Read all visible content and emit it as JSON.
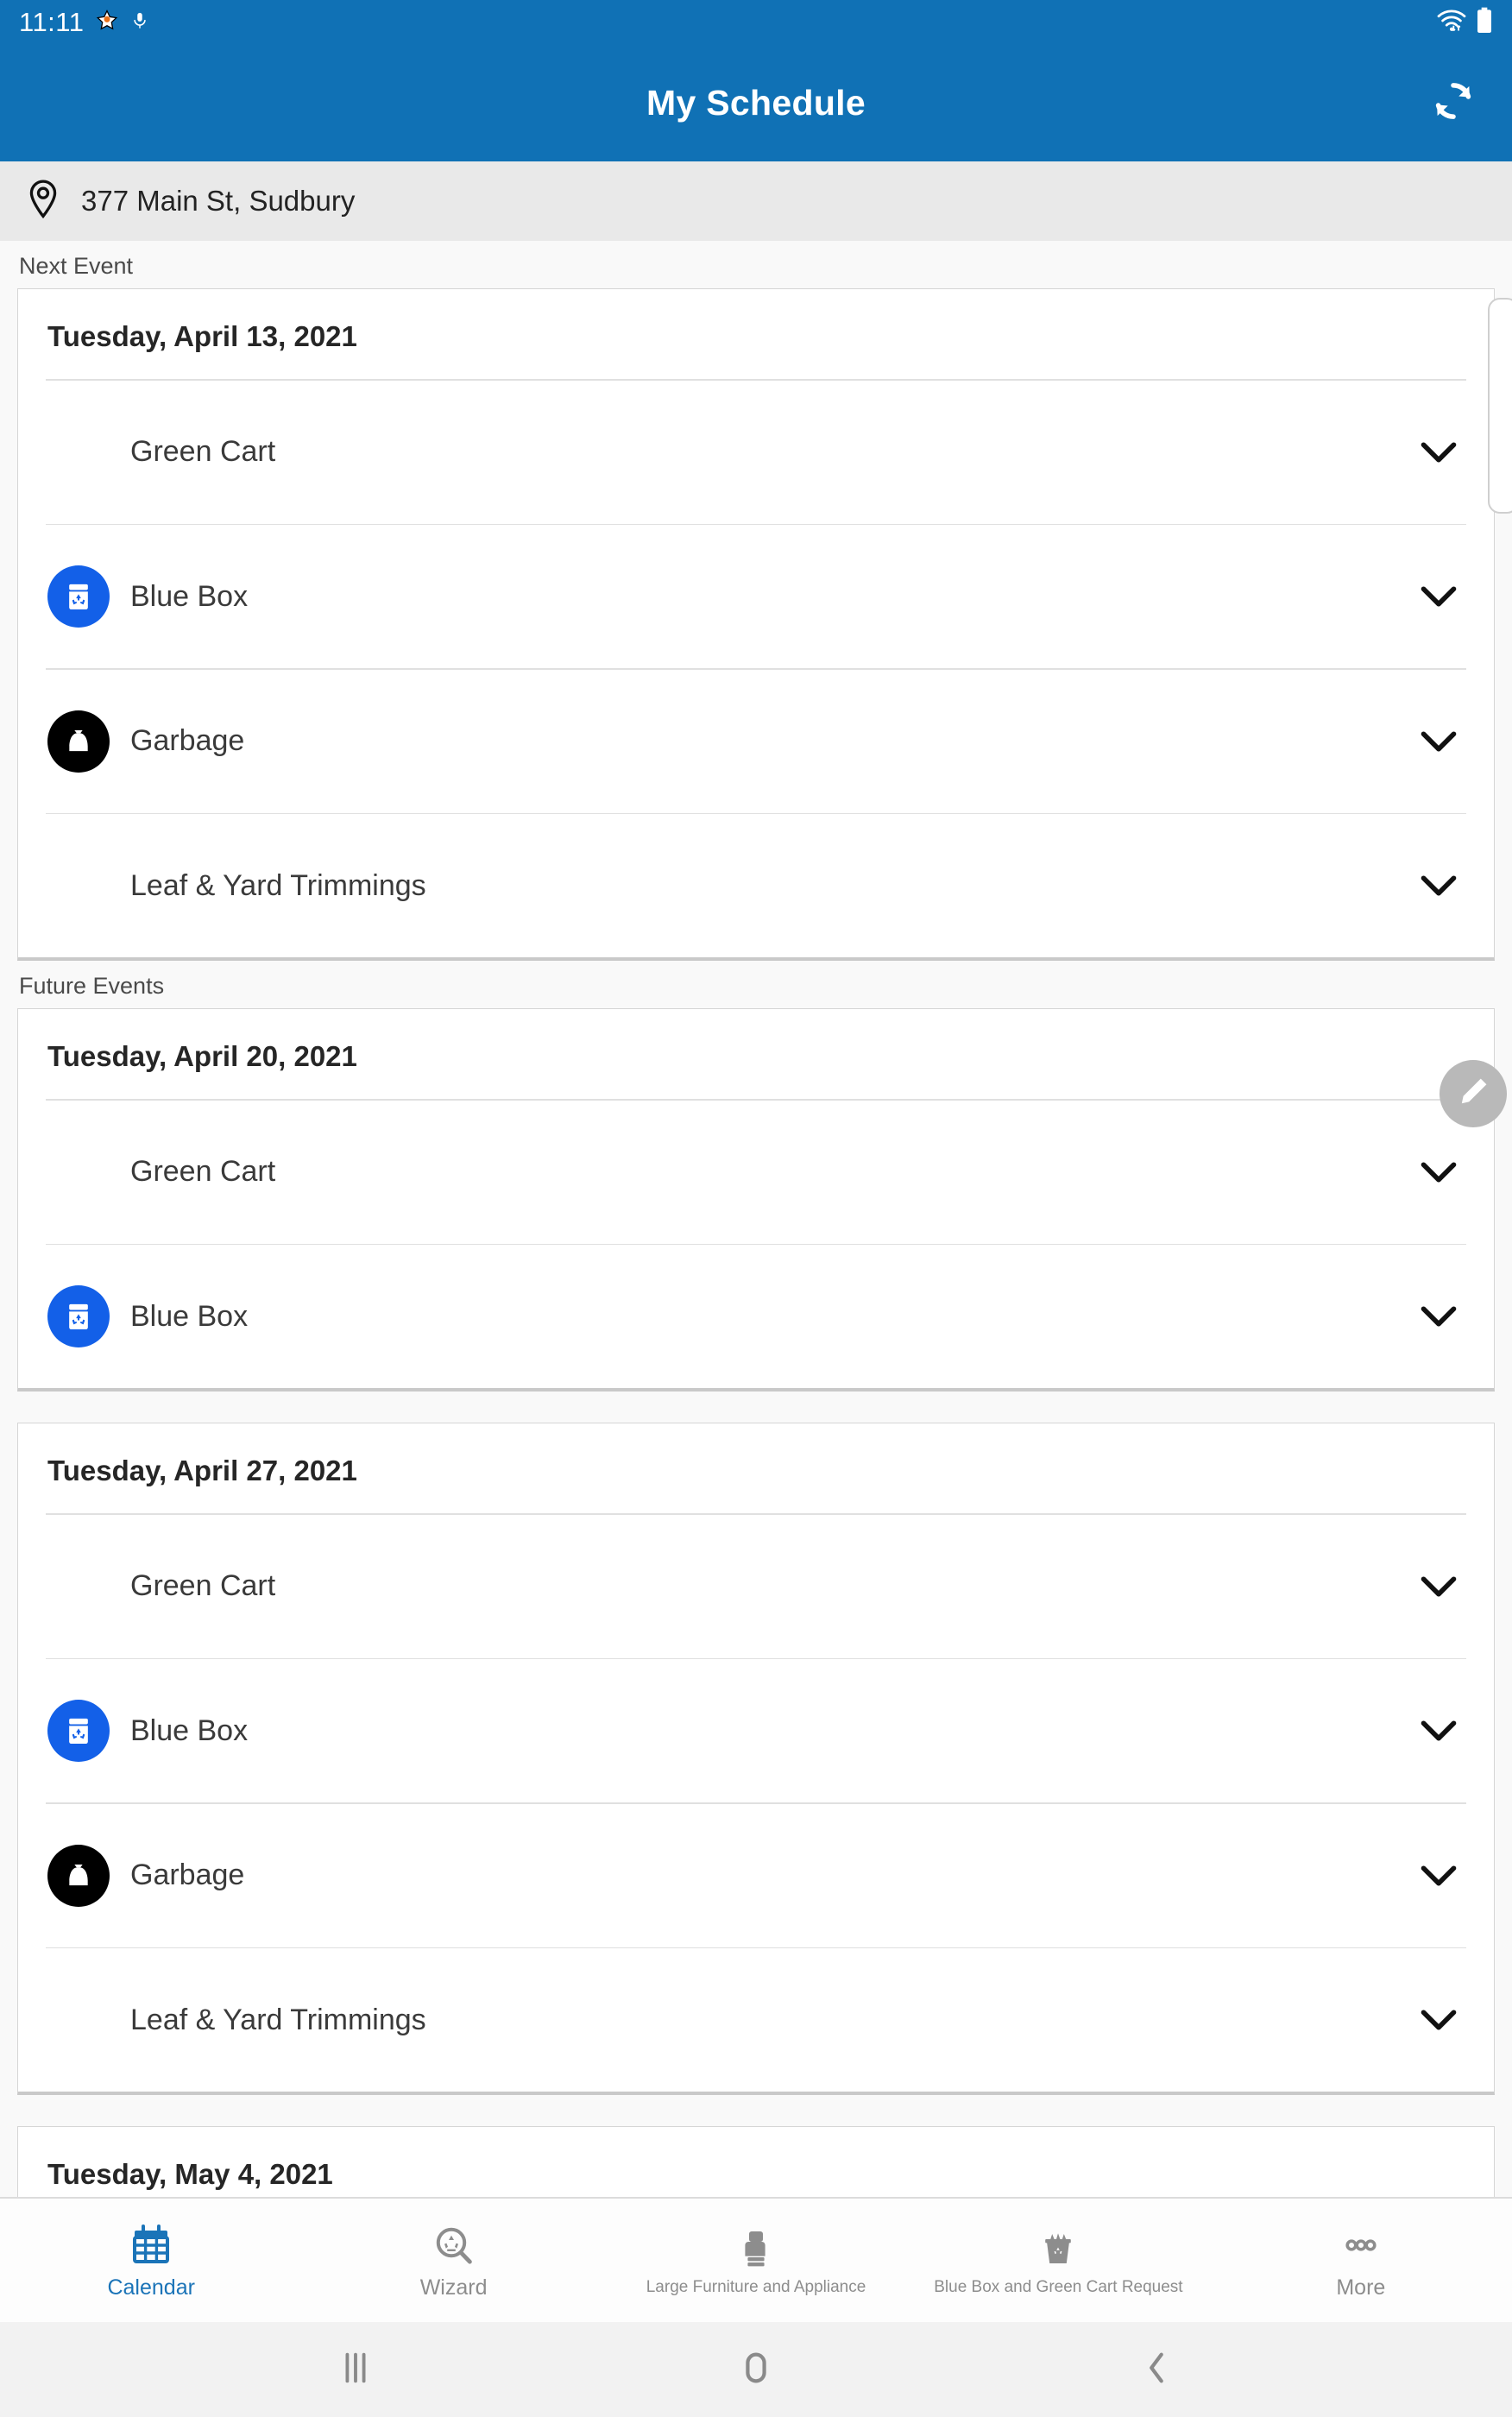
{
  "status_bar": {
    "time": "11:11",
    "icons": [
      "star-icon",
      "microphone-icon",
      "wifi-icon",
      "battery-icon"
    ]
  },
  "app_bar": {
    "title": "My Schedule",
    "action_icon": "refresh-icon"
  },
  "address_bar": {
    "icon": "location-pin-icon",
    "address": "377 Main St, Sudbury"
  },
  "sections": {
    "next_event_label": "Next Event",
    "future_events_label": "Future Events"
  },
  "events": [
    {
      "date": "Tuesday, April 13, 2021",
      "items": [
        {
          "label": "Green Cart",
          "icon": "none",
          "chevron": "chevron-down-icon"
        },
        {
          "label": "Blue Box",
          "icon": "recycle-bin-icon",
          "chevron": "chevron-down-icon"
        },
        {
          "label": "Garbage",
          "icon": "garbage-bag-icon",
          "chevron": "chevron-down-icon"
        },
        {
          "label": "Leaf & Yard Trimmings",
          "icon": "none",
          "chevron": "chevron-down-icon"
        }
      ]
    },
    {
      "date": "Tuesday, April 20, 2021",
      "items": [
        {
          "label": "Green Cart",
          "icon": "none",
          "chevron": "chevron-down-icon"
        },
        {
          "label": "Blue Box",
          "icon": "recycle-bin-icon",
          "chevron": "chevron-down-icon"
        }
      ]
    },
    {
      "date": "Tuesday, April 27, 2021",
      "items": [
        {
          "label": "Green Cart",
          "icon": "none",
          "chevron": "chevron-down-icon"
        },
        {
          "label": "Blue Box",
          "icon": "recycle-bin-icon",
          "chevron": "chevron-down-icon"
        },
        {
          "label": "Garbage",
          "icon": "garbage-bag-icon",
          "chevron": "chevron-down-icon"
        },
        {
          "label": "Leaf & Yard Trimmings",
          "icon": "none",
          "chevron": "chevron-down-icon"
        }
      ]
    },
    {
      "date": "Tuesday, May 4, 2021",
      "items": []
    }
  ],
  "fab": {
    "icon": "pencil-edit-icon"
  },
  "bottom_nav": {
    "items": [
      {
        "label": "Calendar",
        "icon": "calendar-icon",
        "active": true
      },
      {
        "label": "Wizard",
        "icon": "recycle-search-icon",
        "active": false
      },
      {
        "label": "Large Furniture and Appliance",
        "icon": "furniture-icon",
        "active": false
      },
      {
        "label": "Blue Box and Green Cart Request",
        "icon": "recycle-bin-full-icon",
        "active": false
      },
      {
        "label": "More",
        "icon": "more-dots-icon",
        "active": false
      }
    ]
  },
  "system_nav": {
    "recents": "recents-icon",
    "home": "home-icon",
    "back": "back-icon"
  },
  "colors": {
    "primary": "#1071b5",
    "blue_box": "#1360e8",
    "garbage": "#000000",
    "accent_nav": "#1b74b8"
  }
}
